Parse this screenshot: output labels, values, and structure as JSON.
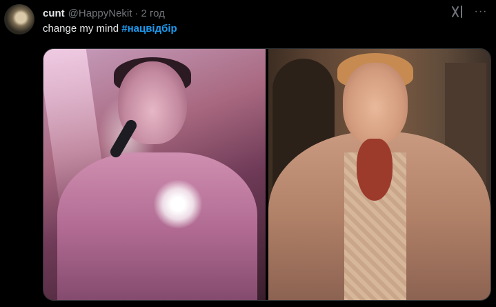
{
  "tweet": {
    "display_name": "cunt",
    "handle": "@HappyNekit",
    "separator": "·",
    "time": "2 год",
    "text": "change my mind",
    "hashtag": "#нацвідбір",
    "more_glyph": "···"
  },
  "icons": {
    "avatar": "profile-avatar",
    "grok": "grok-icon",
    "more": "more-options-icon"
  },
  "colors": {
    "background": "#000000",
    "primary_text": "#e7e9ea",
    "secondary_text": "#71767b",
    "hashtag": "#1d9bf0",
    "border": "#2f3336"
  }
}
